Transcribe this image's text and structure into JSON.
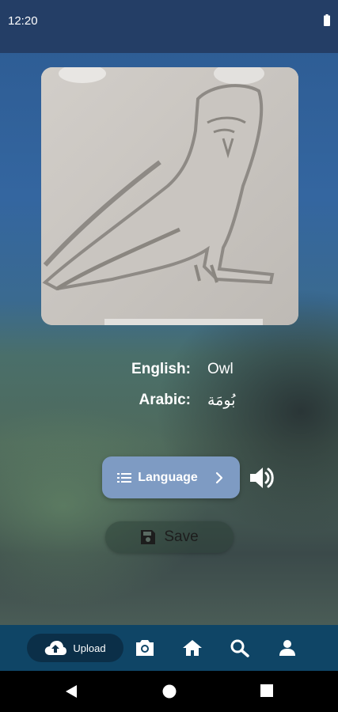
{
  "status_bar": {
    "time": "12:20"
  },
  "result": {
    "english_label": "English:",
    "english_value": "Owl",
    "arabic_label": "Arabic:",
    "arabic_value": "بُومَة"
  },
  "actions": {
    "language_label": "Language",
    "save_label": "Save"
  },
  "bottom_nav": {
    "upload_label": "Upload",
    "items": [
      "upload-icon",
      "camera-icon",
      "home-icon",
      "search-icon",
      "person-icon"
    ]
  },
  "system_nav": [
    "back-icon",
    "home-circle-icon",
    "recents-icon"
  ],
  "colors": {
    "status_bar": "#243e66",
    "language_button": "#7e9bc3",
    "bottom_nav": "#0f4566",
    "upload_pill": "#0b2f48"
  }
}
